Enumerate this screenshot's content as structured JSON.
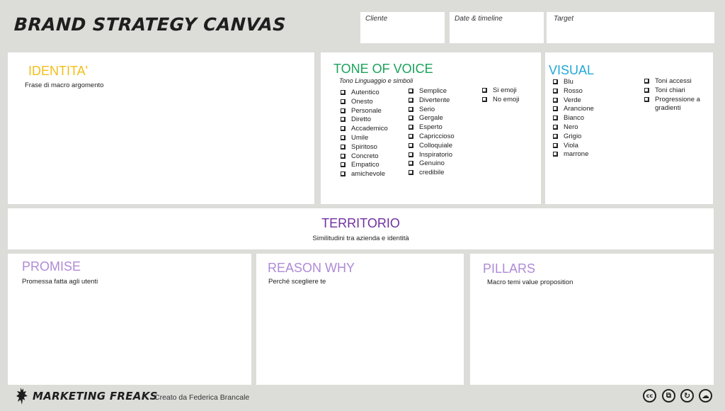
{
  "header": {
    "title": "BRAND STRATEGY CANVAS",
    "fields": [
      {
        "label": "Cliente"
      },
      {
        "label": "Date & timeline"
      },
      {
        "label": "Target"
      }
    ]
  },
  "colors": {
    "identita": "#f2be1a",
    "tone_of_voice": "#1aa35a",
    "visual": "#22a8d8",
    "territorio": "#7030a0",
    "light_purple": "#b08ad6",
    "background": "#dcddd9"
  },
  "identita": {
    "title": "IDENTITA'",
    "subtitle": "Frase di macro argomento"
  },
  "tone_of_voice": {
    "title": "TONE OF VOICE",
    "subtitle": "Tono Linguaggio e simboli",
    "col1": [
      "Autentico",
      "Onesto",
      "Personale",
      "Diretto",
      "Accademico",
      "Umile",
      "Spiritoso",
      "Concreto",
      "Empatico",
      "amichevole"
    ],
    "col2": [
      "Semplice",
      "Divertente",
      "Serio",
      "Gergale",
      "Esperto",
      "Capriccioso",
      "Colloquiale",
      "Inspiratorio",
      "Genuino",
      "credibile"
    ],
    "col3": [
      "Si emoji",
      "No emoji"
    ]
  },
  "visual": {
    "title": "VISUAL",
    "col1": [
      "Blu",
      "Rosso",
      "Verde",
      "Arancione",
      "Bianco",
      "Nero",
      "Grigio",
      "Viola",
      "marrone"
    ],
    "col2": [
      "Toni accessi",
      "Toni chiari",
      "Progressione a gradienti"
    ]
  },
  "territorio": {
    "title": "TERRITORIO",
    "subtitle": "Similitudini tra azienda e identità"
  },
  "promise": {
    "title": "PROMISE",
    "subtitle": "Promessa fatta agli utenti"
  },
  "reason_why": {
    "title": "REASON WHY",
    "subtitle": "Perché scegliere te"
  },
  "pillars": {
    "title": "PILLARS",
    "subtitle": "Macro temi value proposition"
  },
  "footer": {
    "brand": "MARKETING FREAKS",
    "credit": "Creato da Federica Brancale",
    "license_icons": [
      {
        "name": "cc-icon",
        "glyph": "cc"
      },
      {
        "name": "no-derivatives-copy-icon",
        "glyph": "⧉"
      },
      {
        "name": "share-alike-icon",
        "glyph": "↻"
      },
      {
        "name": "attribution-icon",
        "glyph": "☁"
      }
    ]
  }
}
